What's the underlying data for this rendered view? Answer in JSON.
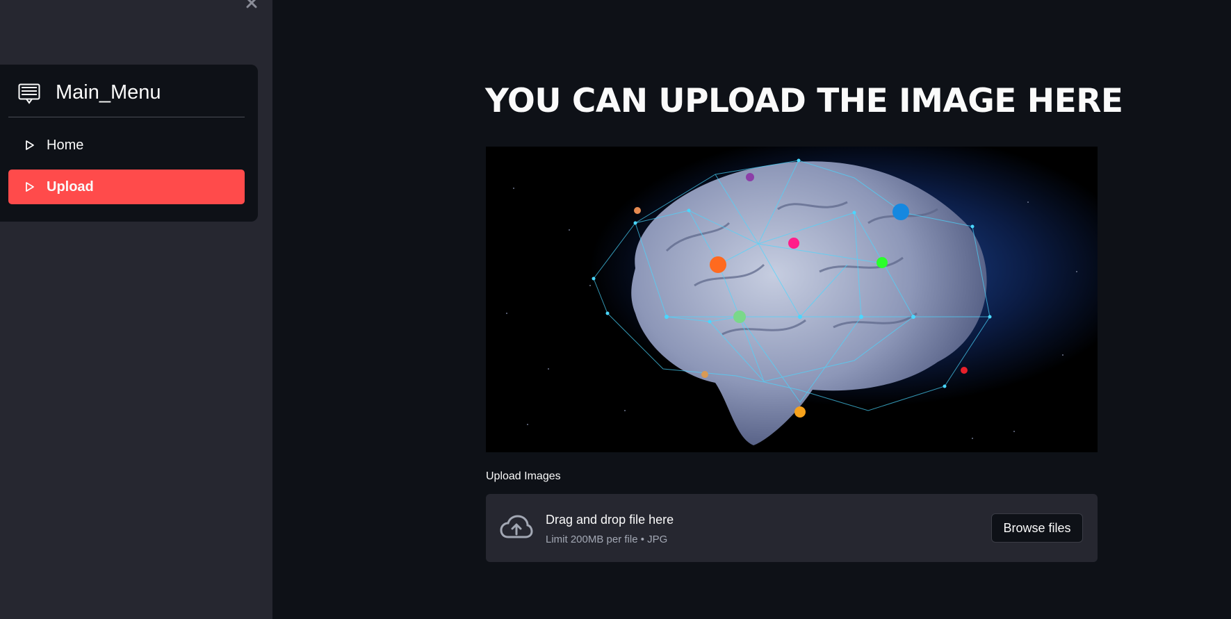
{
  "sidebar": {
    "close_symbol": "×",
    "menu": {
      "title": "Main_Menu",
      "icon": "menu-list-icon",
      "items": [
        {
          "label": "Home",
          "icon": "play-outline-icon",
          "selected": false
        },
        {
          "label": "Upload",
          "icon": "play-outline-icon",
          "selected": true
        }
      ]
    }
  },
  "main": {
    "title": "YOU CAN UPLOAD THE IMAGE HERE",
    "hero_image": "brain-network-illustration",
    "uploader": {
      "label": "Upload Images",
      "drop_text": "Drag and drop file here",
      "limit_text": "Limit 200MB per file • JPG",
      "browse_label": "Browse files",
      "icon": "cloud-upload-icon"
    }
  },
  "colors": {
    "background": "#0e1117",
    "sidebar": "#262730",
    "accent": "#ff4b4b"
  }
}
